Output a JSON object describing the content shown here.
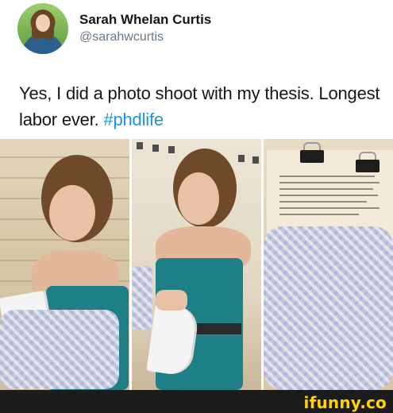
{
  "tweet": {
    "author": {
      "display_name": "Sarah Whelan Curtis",
      "handle": "@sarahwcurtis"
    },
    "text_main": "Yes, I did a photo shoot with my thesis. Longest labor ever. ",
    "hashtag": "#phdlife",
    "colors": {
      "hashtag": "#1b95e0",
      "handle": "#657786",
      "watermark": "#ffd200"
    }
  },
  "photos": [
    {
      "id": "photo-1",
      "description": "woman in teal dress holding thesis wrapped in crocheted blanket"
    },
    {
      "id": "photo-2",
      "description": "woman in teal dress cradling white bound thesis"
    },
    {
      "id": "photo-3",
      "description": "bound thesis pages with binder clips on crocheted blanket"
    }
  ],
  "watermark": {
    "text": "ifunny.co"
  }
}
